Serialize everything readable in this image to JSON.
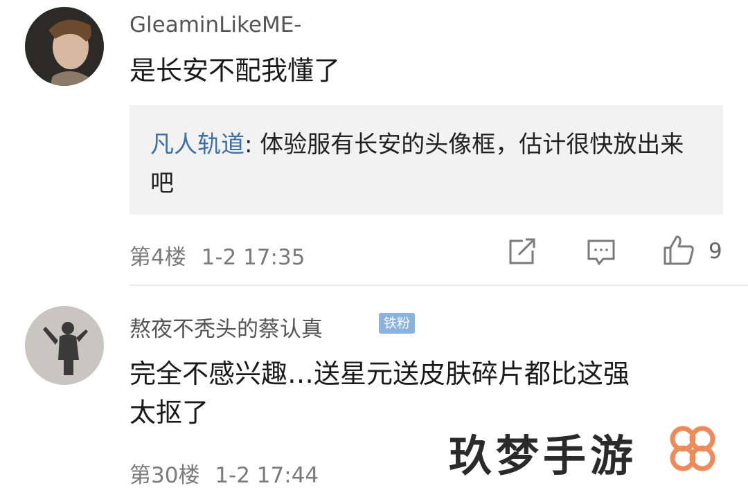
{
  "comments": [
    {
      "username": "GleaminLikeME-",
      "text": "是长安不配我懂了",
      "reply": {
        "author": "凡人轨道",
        "separator": ": ",
        "text": "体验服有长安的头像框，估计很快放出来吧"
      },
      "floor": "第4楼",
      "time": "1-2 17:35",
      "like_count": "9"
    },
    {
      "username": "熬夜不秃头的蔡认真",
      "badge": "铁粉",
      "text_line1": "完全不感兴趣…送星元送皮肤碎片都比这强",
      "text_line2": "太抠了",
      "floor": "第30楼",
      "time": "1-2 17:44"
    }
  ],
  "watermark": {
    "text": "玖梦手游"
  },
  "colors": {
    "link_blue": "#3d6fa8",
    "badge_bg": "#8bb1dd",
    "reply_bg": "#f2f2f2",
    "logo_orange": "#ef8a5a"
  },
  "icons": [
    "share-icon",
    "comment-icon",
    "like-icon"
  ]
}
